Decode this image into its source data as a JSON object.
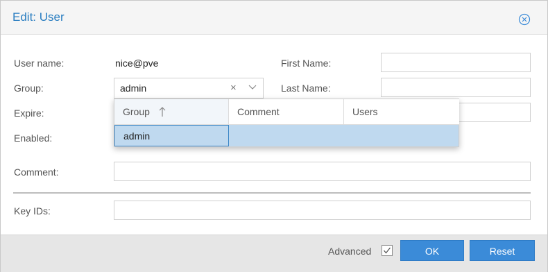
{
  "dialog": {
    "title": "Edit: User",
    "close_icon": "close-circle-icon"
  },
  "form": {
    "user_name_label": "User name:",
    "user_name_value": "nice@pve",
    "group_label": "Group:",
    "group_value": "admin",
    "expire_label": "Expire:",
    "enabled_label": "Enabled:",
    "first_name_label": "First Name:",
    "first_name_value": "",
    "last_name_label": "Last Name:",
    "last_name_value": "",
    "comment_label": "Comment:",
    "comment_value": "",
    "key_ids_label": "Key IDs:",
    "key_ids_value": ""
  },
  "group_dropdown": {
    "columns": [
      "Group",
      "Comment",
      "Users"
    ],
    "sorted_column": "Group",
    "sort_direction": "ascending",
    "rows": [
      {
        "group": "admin",
        "comment": "",
        "users": ""
      }
    ]
  },
  "footer": {
    "advanced_label": "Advanced",
    "advanced_checked": true,
    "ok_label": "OK",
    "reset_label": "Reset"
  },
  "colors": {
    "accent": "#3b8bd8",
    "title": "#2a7ec1",
    "selection": "#bfd9ef"
  }
}
